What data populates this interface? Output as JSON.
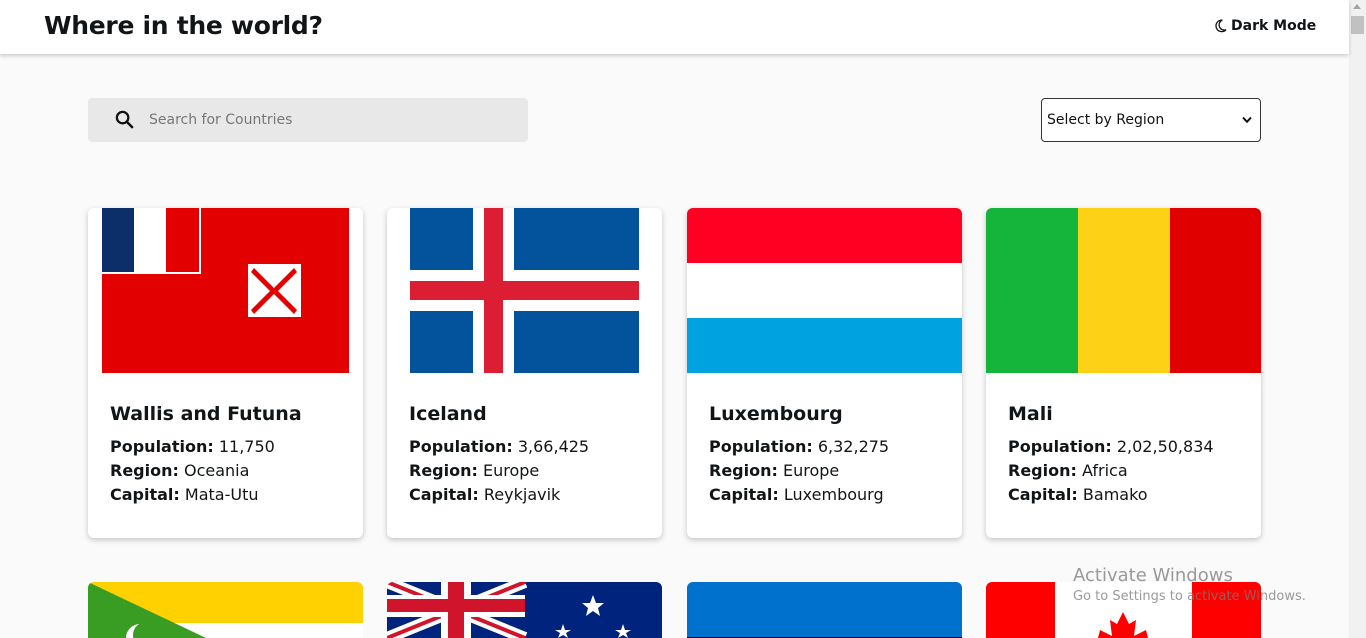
{
  "header": {
    "title": "Where in the world?",
    "dark_mode_label": "Dark Mode",
    "dark_mode_icon": "moon-icon"
  },
  "search": {
    "placeholder": "Search for Countries",
    "value": "",
    "icon": "search-icon"
  },
  "region_filter": {
    "selected": "Select by Region",
    "icon": "chevron-down-icon"
  },
  "labels": {
    "population": "Population:",
    "region": "Region:",
    "capital": "Capital:"
  },
  "countries": [
    {
      "name": "Wallis and Futuna",
      "population": "11,750",
      "region": "Oceania",
      "capital": "Mata-Utu",
      "flag": "wallis-and-futuna-flag"
    },
    {
      "name": "Iceland",
      "population": "3,66,425",
      "region": "Europe",
      "capital": "Reykjavik",
      "flag": "iceland-flag"
    },
    {
      "name": "Luxembourg",
      "population": "6,32,275",
      "region": "Europe",
      "capital": "Luxembourg",
      "flag": "luxembourg-flag"
    },
    {
      "name": "Mali",
      "population": "2,02,50,834",
      "region": "Africa",
      "capital": "Bamako",
      "flag": "mali-flag"
    }
  ],
  "partial_flags": [
    "comoros-flag",
    "australia-flag",
    "estonia-flag",
    "canada-flag"
  ],
  "watermark": {
    "title": "Activate Windows",
    "subtitle": "Go to Settings to activate Windows."
  },
  "colors": {
    "background": "#fafafa",
    "card": "#ffffff",
    "search_bg": "#e8e8e8",
    "text": "#111517"
  }
}
